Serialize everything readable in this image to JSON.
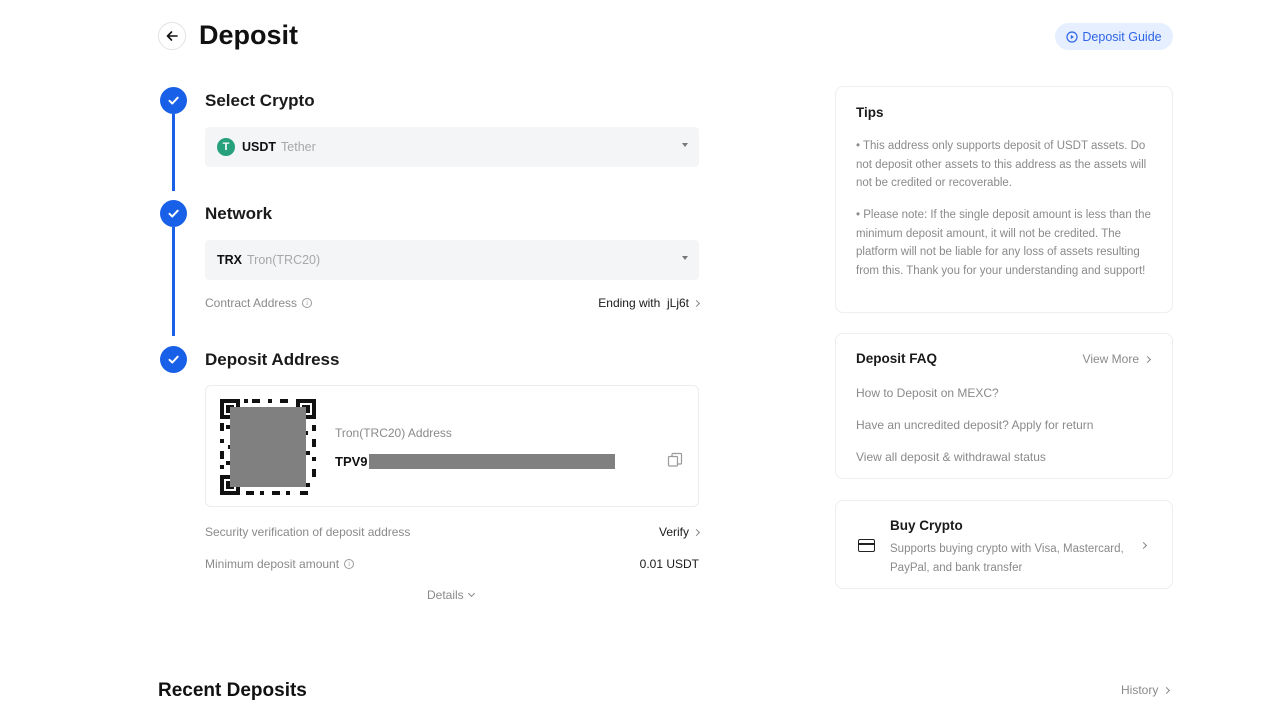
{
  "header": {
    "title": "Deposit",
    "guide_label": "Deposit Guide"
  },
  "steps": {
    "select_crypto": {
      "title": "Select Crypto",
      "coin_symbol": "USDT",
      "coin_name": "Tether",
      "coin_icon": "tether-logo",
      "coin_color": "#26a17b"
    },
    "network": {
      "title": "Network",
      "network_symbol": "TRX",
      "network_name": "Tron(TRC20)",
      "contract_label": "Contract Address",
      "contract_value": "Ending with  jLj6t"
    },
    "deposit_address": {
      "title": "Deposit Address",
      "address_label": "Tron(TRC20) Address",
      "address_prefix": "TPV9",
      "security_label": "Security verification of deposit address",
      "security_action": "Verify",
      "min_label": "Minimum deposit amount",
      "min_value": "0.01 USDT",
      "details_label": "Details"
    }
  },
  "tips": {
    "title": "Tips",
    "items": [
      "• This address only supports deposit of USDT assets. Do not deposit other assets to this address as the assets will not be credited or recoverable.",
      "• Please note: If the single deposit amount is less than the minimum deposit amount, it will not be credited. The platform will not be liable for any loss of assets resulting from this. Thank you for your understanding and support!"
    ]
  },
  "faq": {
    "title": "Deposit FAQ",
    "view_more": "View More",
    "links": [
      "How to Deposit on MEXC?",
      "Have an uncredited deposit? Apply for return",
      "View all deposit & withdrawal status"
    ]
  },
  "buy_crypto": {
    "title": "Buy Crypto",
    "description": "Supports buying crypto with Visa, Mastercard, PayPal, and bank transfer"
  },
  "recent": {
    "title": "Recent Deposits",
    "history_label": "History"
  },
  "colors": {
    "accent": "#1960e8",
    "guide_bg": "#e6efff",
    "guide_text": "#2f64e6"
  }
}
